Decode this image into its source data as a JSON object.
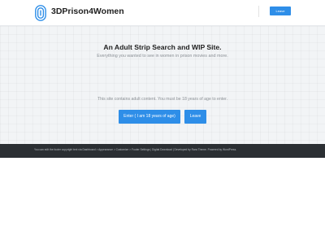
{
  "header": {
    "site_title": "3DPrison4Women",
    "logo_icon": "fingerprint-icon",
    "button_label": "Leave"
  },
  "hero": {
    "headline": "An Adult Strip Search and WIP Site.",
    "subheadline": "Everything you wanted to see in women in prison movies and more.",
    "notice": "This site contains adult content. You must be 18 years of age to enter.",
    "enter_label": "Enter ( I am 18 years of age)",
    "leave_label": "Leave"
  },
  "footer": {
    "text": "You can edit the footer copyright text via Dashboard > Appearance > Customize > Footer Settings | Digital Download | Developed by Rara Theme. Powered by WordPress."
  },
  "colors": {
    "accent": "#2e8ee8",
    "footer_bg": "#2b2f33",
    "hero_bg": "#f2f4f6"
  }
}
